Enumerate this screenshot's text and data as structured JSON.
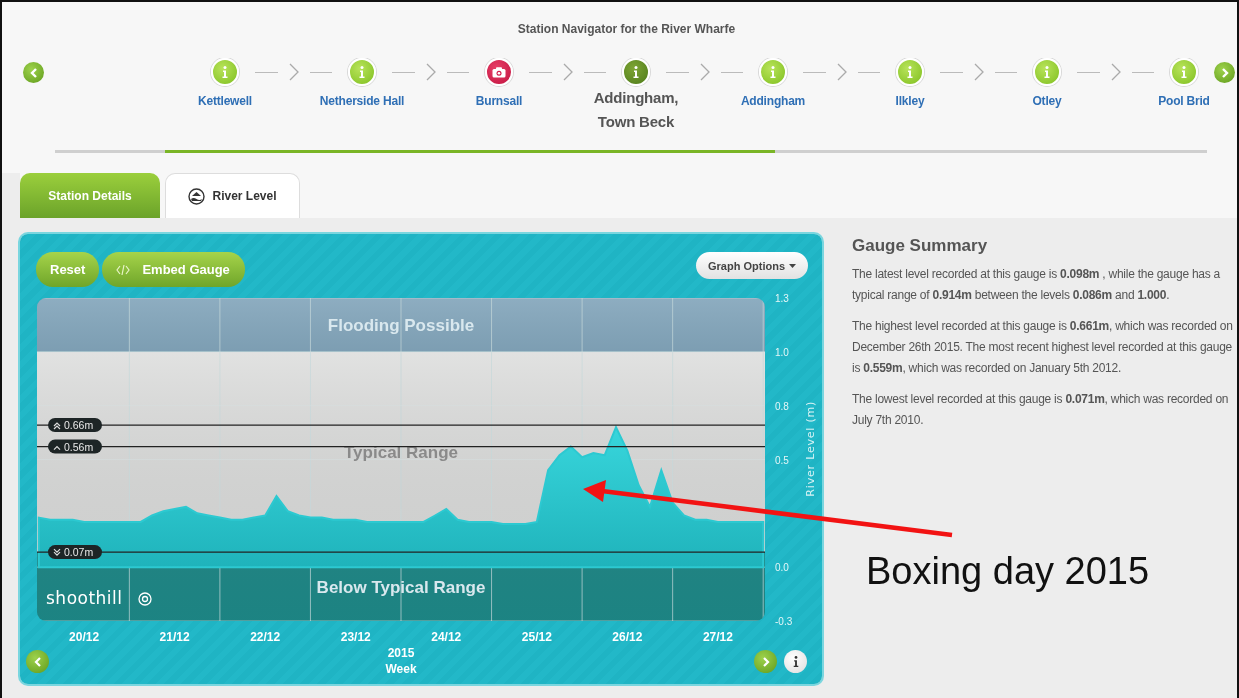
{
  "navigator": {
    "title": "Station Navigator for the River Wharfe",
    "stations": [
      {
        "name": "Kettlewell",
        "kind": "info",
        "selected": false
      },
      {
        "name": "Netherside Hall",
        "kind": "info",
        "selected": false
      },
      {
        "name": "Burnsall",
        "kind": "camera",
        "selected": false
      },
      {
        "name": "Addingham, Town Beck",
        "kind": "info",
        "selected": true
      },
      {
        "name": "Addingham",
        "kind": "info",
        "selected": false
      },
      {
        "name": "Ilkley",
        "kind": "info",
        "selected": false
      },
      {
        "name": "Otley",
        "kind": "info",
        "selected": false
      },
      {
        "name": "Pool Brid",
        "kind": "info",
        "selected": false
      }
    ]
  },
  "tabs": [
    {
      "label": "Station Details",
      "selected": false
    },
    {
      "label": "River Level",
      "selected": true
    }
  ],
  "chart": {
    "buttons": [
      "Reset",
      "Embed Gauge"
    ],
    "options_button": "Graph Options",
    "logo": "shoothill",
    "year": "2015",
    "period": "Week",
    "chart_data": {
      "type": "area",
      "ylabel": "River Level (m)",
      "ylim": [
        -0.25,
        1.25
      ],
      "grid": true,
      "yticks": [
        {
          "value": 1.25,
          "label": "1.3"
        },
        {
          "value": 1.0,
          "label": "1.0"
        },
        {
          "value": 0.75,
          "label": "0.8"
        },
        {
          "value": 0.5,
          "label": "0.5"
        },
        {
          "value": 0,
          "label": "0.0"
        },
        {
          "value": -0.25,
          "label": "-0.3"
        }
      ],
      "categories": [
        null,
        null,
        null,
        null,
        "20/12",
        null,
        null,
        null,
        null,
        null,
        null,
        null,
        "21/12",
        null,
        null,
        null,
        null,
        null,
        null,
        null,
        "22/12",
        null,
        null,
        null,
        null,
        null,
        null,
        null,
        "23/12",
        null,
        null,
        null,
        null,
        null,
        null,
        null,
        "24/12",
        null,
        null,
        null,
        null,
        null,
        null,
        null,
        "25/12",
        null,
        null,
        null,
        null,
        null,
        null,
        null,
        "26/12",
        null,
        null,
        null,
        null,
        null,
        null,
        null,
        "27/12",
        null,
        null,
        null,
        null
      ],
      "series": [
        {
          "color": "#2cc9d1",
          "values": [
            0.23,
            0.22,
            0.22,
            0.22,
            0.21,
            0.21,
            0.21,
            0.21,
            0.21,
            0.21,
            0.24,
            0.26,
            0.27,
            0.28,
            0.25,
            0.24,
            0.23,
            0.22,
            0.22,
            0.23,
            0.24,
            0.33,
            0.26,
            0.24,
            0.23,
            0.23,
            0.22,
            0.22,
            0.22,
            0.21,
            0.21,
            0.21,
            0.21,
            0.21,
            0.21,
            0.24,
            0.27,
            0.22,
            0.21,
            0.21,
            0.21,
            0.2,
            0.2,
            0.2,
            0.21,
            0.45,
            0.52,
            0.56,
            0.51,
            0.53,
            0.52,
            0.65,
            0.54,
            0.38,
            0.28,
            0.45,
            0.3,
            0.24,
            0.22,
            0.22,
            0.21,
            0.21,
            0.21,
            0.21,
            0.21
          ]
        }
      ],
      "bands": [
        {
          "axis": "y",
          "from": 1.0,
          "to": 1.25,
          "label": "Flooding Possible",
          "color": "#5d8aa6"
        },
        {
          "axis": "y",
          "from": 0.07,
          "to": 1.0,
          "label": "Typical Range",
          "color": "#e6e7e6"
        },
        {
          "axis": "y",
          "from": -0.25,
          "to": 0.07,
          "label": "Below Typical Range",
          "color": "#1f8f8e"
        }
      ],
      "ref_lines": [
        {
          "axis": "y",
          "value": 0.66,
          "label": "0.66m"
        },
        {
          "axis": "y",
          "value": 0.56,
          "label": "0.56m"
        },
        {
          "axis": "y",
          "value": 0.07,
          "label": "0.07m"
        }
      ]
    }
  },
  "summary": {
    "title": "Gauge Summary",
    "paragraphs": [
      "The latest level recorded at this gauge is **0.098m** , while the gauge has a typical range of **0.914m** between the levels **0.086m** and **1.000**.",
      "The highest level recorded at this gauge is **0.661m**, which was recorded on December 26th 2015. The most recent highest level recorded at this gauge is **0.559m**, which was recorded on January 5th 2012.",
      "The lowest level recorded at this gauge is **0.071m**, which was recorded on July 7th 2010."
    ]
  },
  "callout": {
    "text": "Boxing day 2015"
  }
}
